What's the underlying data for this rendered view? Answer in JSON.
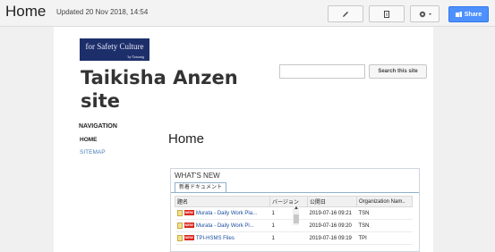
{
  "topbar": {
    "title": "Home",
    "updated": "Updated 20 Nov 2018, 14:54",
    "edit_icon": "pencil-icon",
    "page_icon": "new-page-icon",
    "settings_icon": "gear-icon",
    "share_label": "Share",
    "share_color": "#4d90fe"
  },
  "header": {
    "logo_text": "for Safety Culture",
    "logo_small": "by Taisanig",
    "site_title": "Taikisha Anzen site",
    "search_placeholder": "",
    "search_button": "Search this site"
  },
  "nav": {
    "heading": "NAVIGATION",
    "items": [
      "HOME",
      "SITEMAP"
    ]
  },
  "main": {
    "heading": "Home"
  },
  "whats_new": {
    "title": "WHAT'S NEW",
    "tab": "新着ドキュメント",
    "columns": [
      "題名",
      "バージョン",
      "公開日",
      "Organization Nam.."
    ],
    "rows": [
      {
        "name": "Murata - Daily Work Pla...",
        "version": "1",
        "date": "2019-07-16 09:21",
        "org": "TSN"
      },
      {
        "name": "Murata - Daily Work Pl...",
        "version": "1",
        "date": "2019-07-16 09:20",
        "org": "TSN"
      },
      {
        "name": "TPI-HSMS Files",
        "version": "1",
        "date": "2019-07-16 09:19",
        "org": "TPI"
      }
    ],
    "badge": "NEW"
  }
}
